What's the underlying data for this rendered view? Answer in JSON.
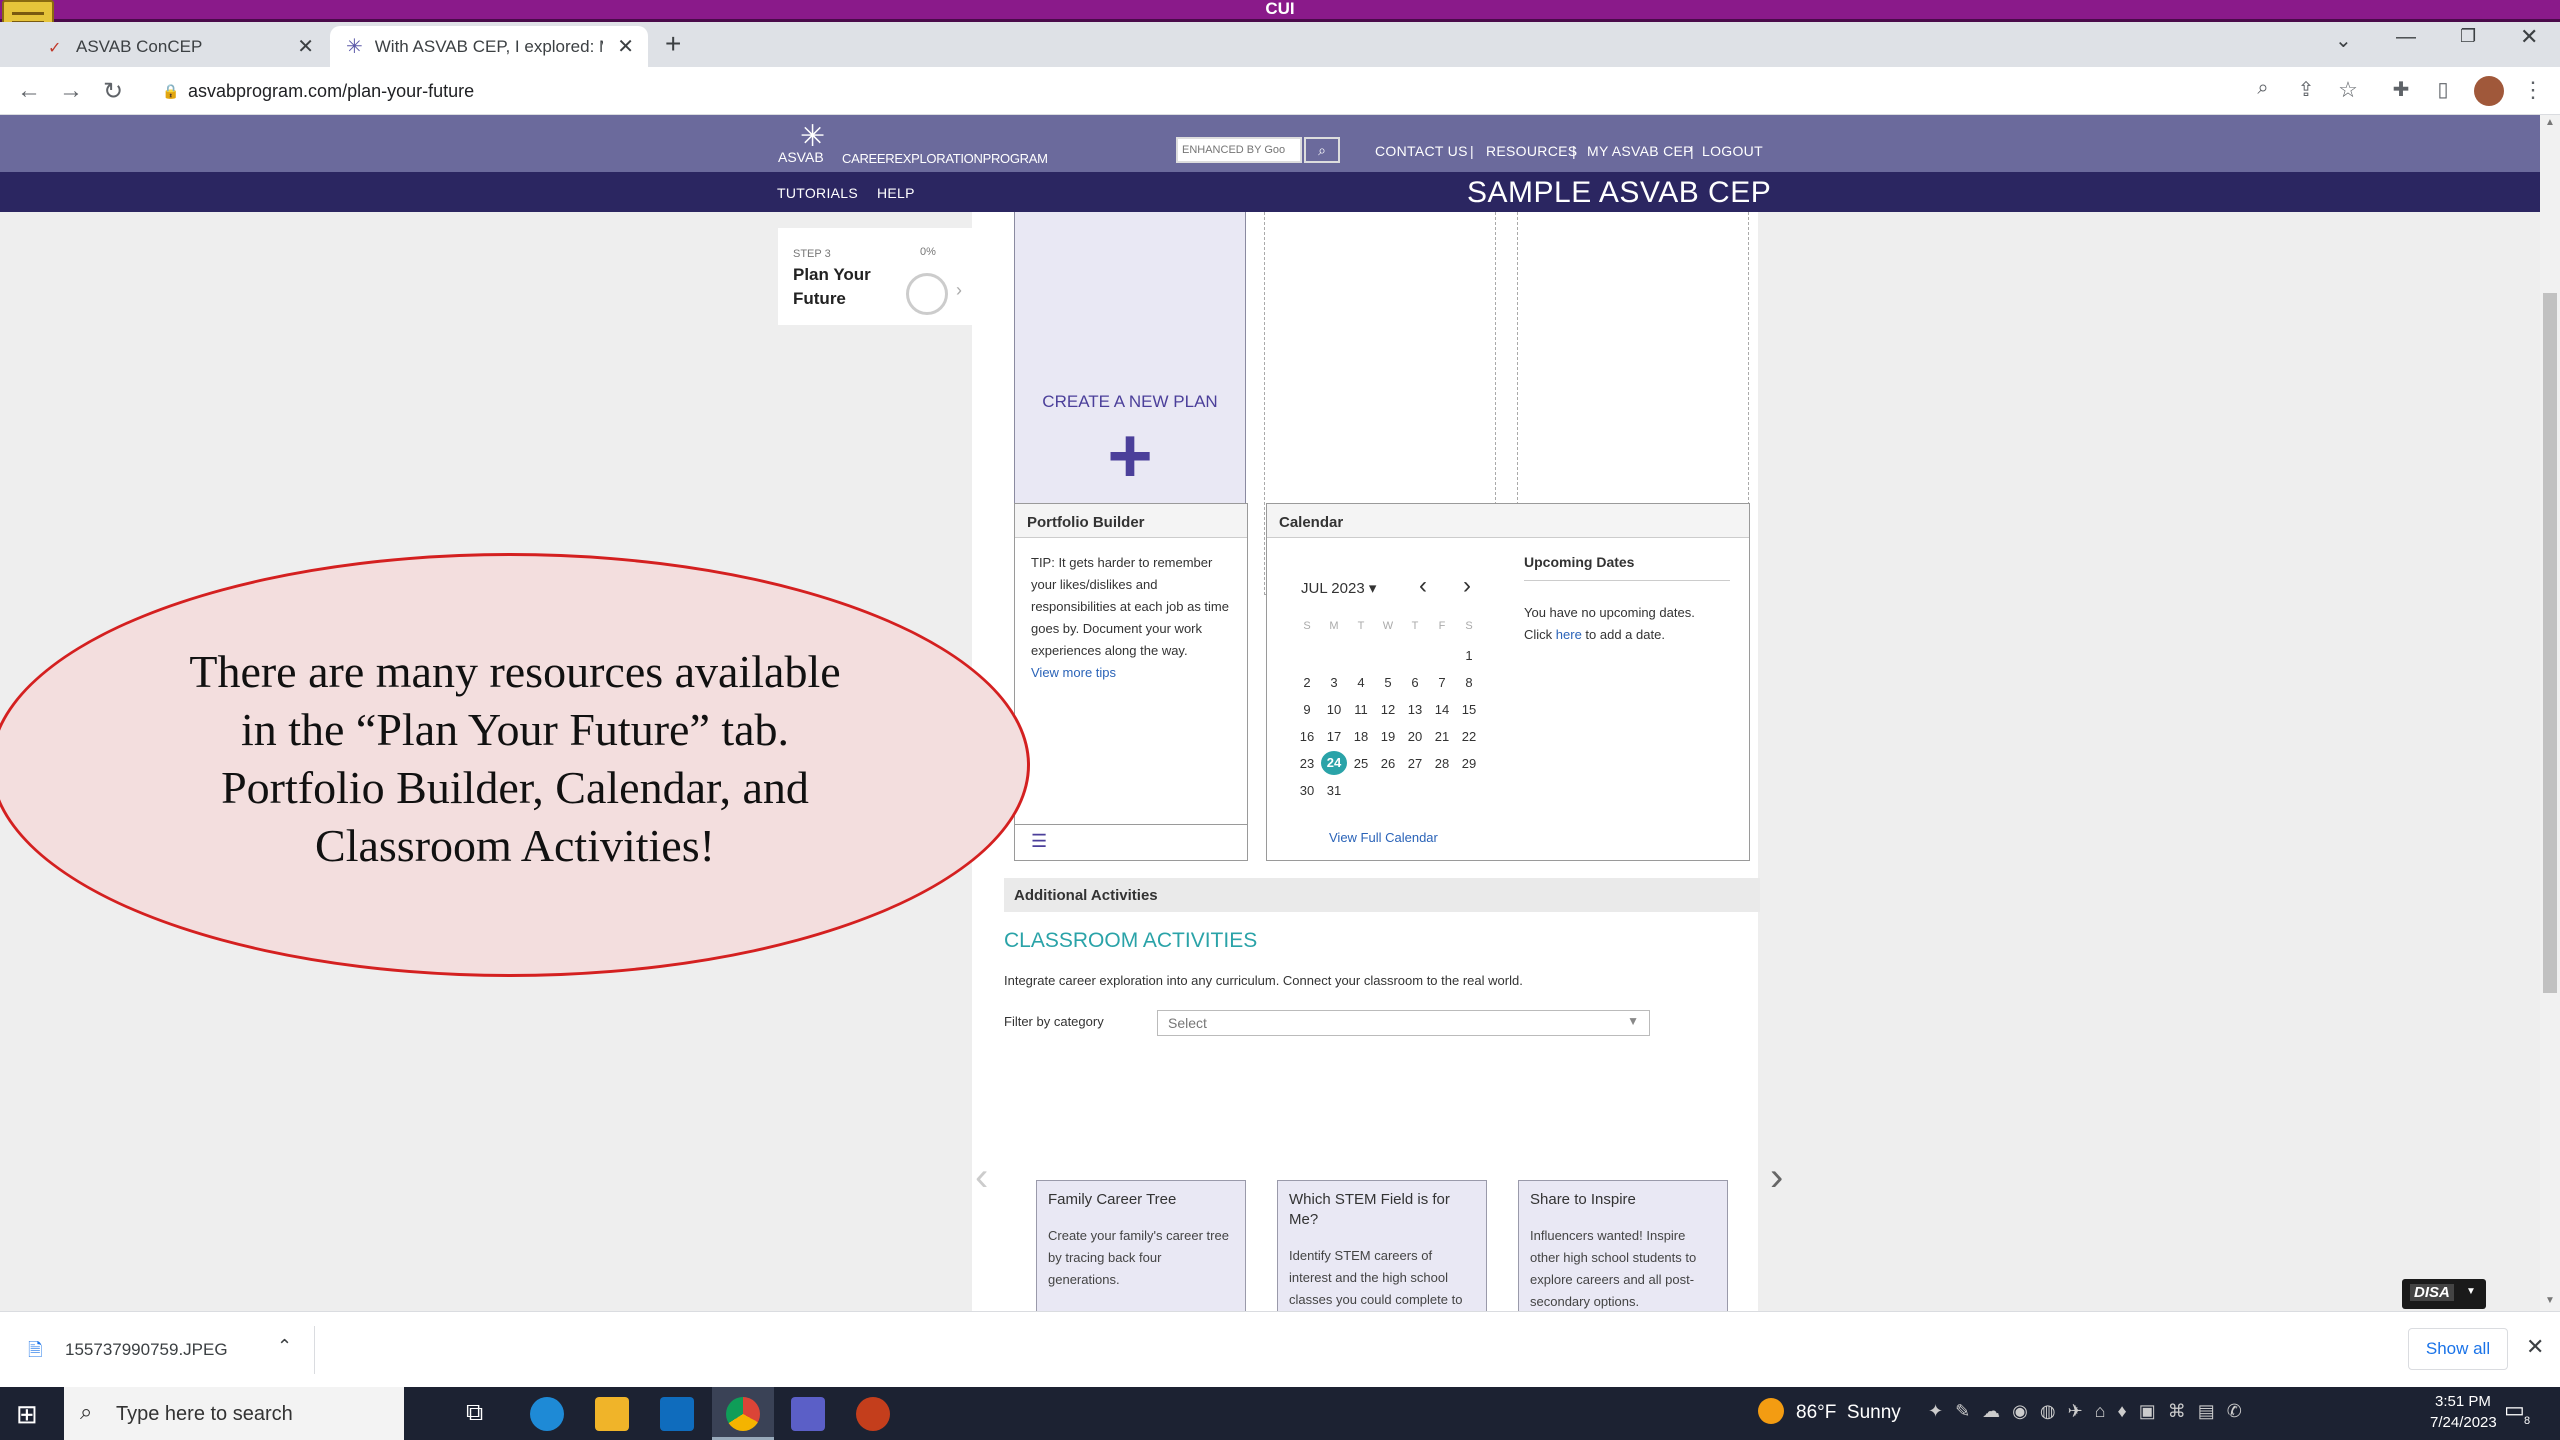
{
  "cui_banner": "CUI",
  "browser": {
    "tabs": [
      {
        "label": "ASVAB ConCEP"
      },
      {
        "label": "With ASVAB CEP, I explored: Me"
      }
    ],
    "url": "asvabprogram.com/plan-your-future"
  },
  "site": {
    "logo_text": "ASVAB",
    "logo_subtitle": "CAREEREXPLORATIONPROGRAM",
    "search_placeholder": "ENHANCED BY Goo",
    "nav": [
      "CONTACT US",
      "RESOURCES",
      "MY ASVAB CEP",
      "LOGOUT"
    ],
    "subnav": [
      "TUTORIALS",
      "HELP"
    ],
    "banner_title": "SAMPLE ASVAB CEP"
  },
  "step": {
    "label": "STEP 3",
    "percent": "0%",
    "title_line1": "Plan Your",
    "title_line2": "Future"
  },
  "plans": {
    "create_label": "CREATE A NEW PLAN",
    "plus": "+"
  },
  "portfolio": {
    "title": "Portfolio Builder",
    "tip": "TIP: It gets harder to remember your likes/dislikes and responsibilities at each job as time goes by. Document your work experiences along the way.",
    "link": "View more tips"
  },
  "calendar": {
    "title": "Calendar",
    "month": "JUL 2023",
    "weekdays": [
      "S",
      "M",
      "T",
      "W",
      "T",
      "F",
      "S"
    ],
    "weeks": [
      [
        "",
        "",
        "",
        "",
        "",
        "",
        "1"
      ],
      [
        "2",
        "3",
        "4",
        "5",
        "6",
        "7",
        "8"
      ],
      [
        "9",
        "10",
        "11",
        "12",
        "13",
        "14",
        "15"
      ],
      [
        "16",
        "17",
        "18",
        "19",
        "20",
        "21",
        "22"
      ],
      [
        "23",
        "24",
        "25",
        "26",
        "27",
        "28",
        "29"
      ],
      [
        "30",
        "31",
        "",
        "",
        "",
        "",
        ""
      ]
    ],
    "today": "24",
    "upcoming_title": "Upcoming Dates",
    "upcoming_text_1": "You have no upcoming dates.",
    "upcoming_text_2a": "Click ",
    "upcoming_link": "here",
    "upcoming_text_2b": " to add a date.",
    "full_link": "View Full Calendar"
  },
  "additional": {
    "header": "Additional Activities",
    "title": "CLASSROOM ACTIVITIES",
    "description": "Integrate career exploration into any curriculum. Connect your classroom to the real world.",
    "filter_label": "Filter by category",
    "filter_value": "Select",
    "activities": [
      {
        "title": "Family Career Tree",
        "desc": "Create your family's career tree by tracing back four generations."
      },
      {
        "title": "Which STEM Field is for Me?",
        "desc": "Identify STEM careers of interest and the high school classes you could complete to prepare."
      },
      {
        "title": "Share to Inspire",
        "desc": "Influencers wanted! Inspire other high school students to explore careers and all post-secondary options."
      }
    ]
  },
  "callout": {
    "line1": "There are many resources available",
    "line2": "in the “Plan Your Future” tab.",
    "line3": "Portfolio Builder, Calendar, and",
    "line4": "Classroom Activities!"
  },
  "disa_badge": "DISA",
  "downloads": {
    "file": "155737990759.JPEG",
    "show_all": "Show all"
  },
  "taskbar": {
    "search_placeholder": "Type here to search",
    "weather": "86°F  Sunny",
    "time": "3:51 PM",
    "date": "7/24/2023",
    "notif_count": "8"
  },
  "colors": {
    "header": "#6b6a9c",
    "subheader": "#2b2661",
    "accent_teal": "#2aa3a8",
    "link_blue": "#2a63b8",
    "plus_purple": "#4b3f9a",
    "callout_fill": "#f3dede",
    "callout_border": "#d42020"
  }
}
